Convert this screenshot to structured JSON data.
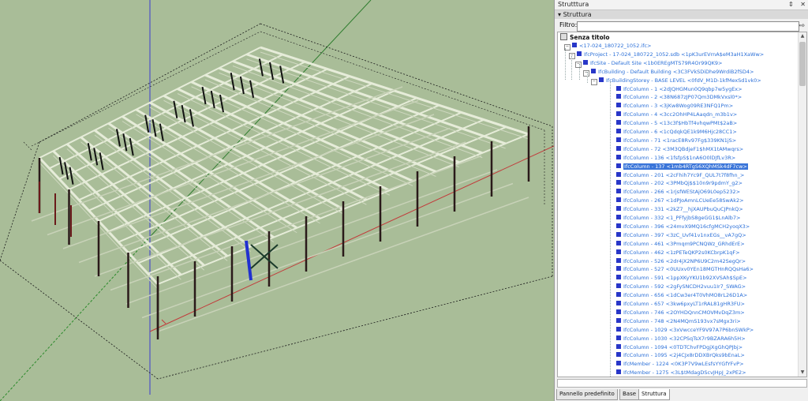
{
  "panel": {
    "title": "Strutttura",
    "controls": [
      "⇕",
      "✕"
    ],
    "section": "Struttura",
    "filter_label": "Filtro:",
    "filter_value": "",
    "root_label": "Senza titolo",
    "nodes": [
      "<17-024_180722_1052.ifc>",
      "IfcProject - 17-024_180722_1052.sdb <1pK3urEVrnA$eM3aH1XaWw>",
      "IfcSite - Default Site <1b0EREgMTS79R4Or99QK9>",
      "IfcBuilding - Default Building <3C3FVkSDiDhe9WrdiB2fSD4>",
      "IfcBuildingStorey - BASE LEVEL <0fdV_M1D-1kfMexSd1vk0>",
      "IfcColumn - 1 <2dJQHGMun0Q9qbp7w5ygEx>",
      "IfcColumn - 2 <38N687zJP07Qm3DMkVxsl0*>",
      "IfcColumn - 3 <3jKw8Wog09RE3NFQ1Pm>",
      "IfcColumn - 4 <3cc2OhHP4LAaqdn_m3b1v>",
      "IfcColumn - 5 <13c3f$HbTf4vhqwPMt$2aB>",
      "IfcColumn - 6 <1cQdqkQE1k9M6Hjc28CC1>",
      "IfcColumn - 71 <1racE8Rv97Fg$339KN1jS>",
      "IfcColumn - 72 <3M3QBdjeF1$hMX1tAMwqrs>",
      "IfcColumn - 136 <1fsfpS$1nA6O0lDJfLv3R>",
      "IfcColumn - 137 <1mb4RTgS6XQhMSk4dF7cw>",
      "IfcColumn - 201 <2cFhih7Yc9F_QUL7t7f8fhn_>",
      "IfcColumn - 202 <3PMbQj$$10n9r9pdmY_g2>",
      "IfcColumn - 266 <1rjsfWEStAjO69L0ep5232>",
      "IfcColumn - 267 <1dPJoAmnLCUeEe58SwAk2>",
      "IfcColumn - 331 <2kZ7__hjXAUPbuQuCJPnkQ>",
      "IfcColumn - 332 <1_PFfyjbS8geGG1$LnAlb7>",
      "IfcColumn - 396 <24mvX9MQ16cfgMCH2yoqX3>",
      "IfcColumn - 397 <3zC_Uvf41v1nxEGs__vA7gQ>",
      "IfcColumn - 461 <3Pmqm9PCNQWz_GRhdErE>",
      "IfcColumn - 462 <1zPETeQKP2s0KCbrpK1qF>",
      "IfcColumn - 526 <2dr4jX2NP6U9C2m42SegQr>",
      "IfcColumn - 527 <0UUxv0YEn18MGTHnRQQsHa6>",
      "IfcColumn - 591 <1ppXKyYKU1b92XVSAh$SpE>",
      "IfcColumn - 592 <2gFySNCDH2vuu1Ir7_SWAG>",
      "IfcColumn - 656 <1dCw3er4T0VhMO8rL26D1A>",
      "IfcColumn - 657 <3kw6pxyLT1rRAL81gHR3FU>",
      "IfcColumn - 746 <2OYHDQnnCMOVMvDqZ3m>",
      "IfcColumn - 748 <2N4MQmS193vx7sMgx3ri>",
      "IfcColumn - 1029 <3xVwcceYF9V97A7P6bnSWkP>",
      "IfcColumn - 1030 <32CPSqTsX7r9BZARA6h5H>",
      "IfcColumn - 1094 <0TDTChvFPDgjXgGhQPJbj>",
      "IfcColumn - 1095 <2j4CJx8rDDXBrQks9bEnaL>",
      "IfcMember - 1224 <0K3P7V9wLEsfsYYGfYFvP>",
      "IfcMember - 1275 <3L$tMdagDScvJHpJ_2xPE2>",
      "IfcMember - 1278 <2f3WDAvH8n8SBrEFM4rvF>",
      "IfcMember - 1279 <0AXYptDU16tBL1sBDEYtHR>",
      "IfcMember - 1296 <1XZdPS3rApPbgORTo9kWP>",
      "IfcMember - 1297 <2vP_neeVP0D8ET2ZqsIxEA>"
    ],
    "selected_index": 14,
    "tabs": [
      "Pannello predefinito",
      "Base",
      "Struttura"
    ],
    "active_tab": 2
  }
}
